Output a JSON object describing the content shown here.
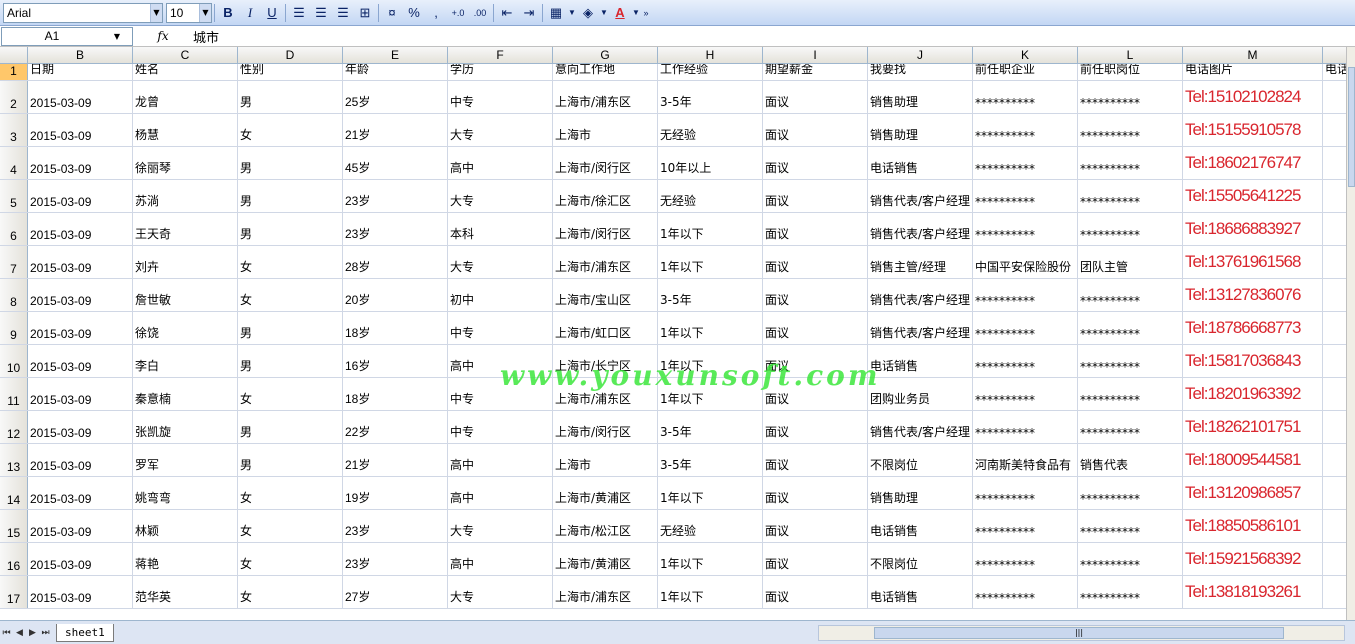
{
  "toolbar": {
    "font_name": "Arial",
    "font_size": "10",
    "bold": "B",
    "italic": "I",
    "underline": "U",
    "percent": "%",
    "comma": ",",
    "inc_decimal": "+.0",
    "dec_decimal": ".00",
    "font_color_label": "A"
  },
  "formula_bar": {
    "cell_ref": "A1",
    "fx": "fx",
    "content": "城市"
  },
  "columns": [
    "B",
    "C",
    "D",
    "E",
    "F",
    "G",
    "H",
    "I",
    "J",
    "K",
    "L",
    "M",
    ""
  ],
  "row_numbers": [
    "1",
    "2",
    "3",
    "4",
    "5",
    "6",
    "7",
    "8",
    "9",
    "10",
    "11",
    "12",
    "13",
    "14",
    "15",
    "16",
    "17"
  ],
  "header_row": [
    "日期",
    "姓名",
    "性别",
    "年龄",
    "学历",
    "意向工作地",
    "工作经验",
    "期望薪金",
    "我要找",
    "前任职企业",
    "前任职岗位",
    "电话图片",
    "电话"
  ],
  "rows": [
    [
      "2015-03-09",
      "龙曾",
      "男",
      "25岁",
      "中专",
      "上海市/浦东区",
      "3-5年",
      "面议",
      "销售助理",
      "**********",
      "**********",
      "Tel:15102102824"
    ],
    [
      "2015-03-09",
      "杨慧",
      "女",
      "21岁",
      "大专",
      "上海市",
      "无经验",
      "面议",
      "销售助理",
      "**********",
      "**********",
      "Tel:15155910578"
    ],
    [
      "2015-03-09",
      "徐丽琴",
      "男",
      "45岁",
      "高中",
      "上海市/闵行区",
      "10年以上",
      "面议",
      "电话销售",
      "**********",
      "**********",
      "Tel:18602176747"
    ],
    [
      "2015-03-09",
      "苏淌",
      "男",
      "23岁",
      "大专",
      "上海市/徐汇区",
      "无经验",
      "面议",
      "销售代表/客户经理",
      "**********",
      "**********",
      "Tel:15505641225"
    ],
    [
      "2015-03-09",
      "王天奇",
      "男",
      "23岁",
      "本科",
      "上海市/闵行区",
      "1年以下",
      "面议",
      "销售代表/客户经理",
      "**********",
      "**********",
      "Tel:18686883927"
    ],
    [
      "2015-03-09",
      "刘卉",
      "女",
      "28岁",
      "大专",
      "上海市/浦东区",
      "1年以下",
      "面议",
      "销售主管/经理",
      "中国平安保险股份",
      "团队主管",
      "Tel:13761961568"
    ],
    [
      "2015-03-09",
      "詹世敏",
      "女",
      "20岁",
      "初中",
      "上海市/宝山区",
      "3-5年",
      "面议",
      "销售代表/客户经理",
      "**********",
      "**********",
      "Tel:13127836076"
    ],
    [
      "2015-03-09",
      "徐饶",
      "男",
      "18岁",
      "中专",
      "上海市/虹口区",
      "1年以下",
      "面议",
      "销售代表/客户经理",
      "**********",
      "**********",
      "Tel:18786668773"
    ],
    [
      "2015-03-09",
      "李白",
      "男",
      "16岁",
      "高中",
      "上海市/长宁区",
      "1年以下",
      "面议",
      "电话销售",
      "**********",
      "**********",
      "Tel:15817036843"
    ],
    [
      "2015-03-09",
      "秦意楠",
      "女",
      "18岁",
      "中专",
      "上海市/浦东区",
      "1年以下",
      "面议",
      "团购业务员",
      "**********",
      "**********",
      "Tel:18201963392"
    ],
    [
      "2015-03-09",
      "张凯旋",
      "男",
      "22岁",
      "中专",
      "上海市/闵行区",
      "3-5年",
      "面议",
      "销售代表/客户经理",
      "**********",
      "**********",
      "Tel:18262101751"
    ],
    [
      "2015-03-09",
      "罗军",
      "男",
      "21岁",
      "高中",
      "上海市",
      "3-5年",
      "面议",
      "不限岗位",
      "河南斯美特食品有",
      "销售代表",
      "Tel:18009544581"
    ],
    [
      "2015-03-09",
      "姚弯弯",
      "女",
      "19岁",
      "高中",
      "上海市/黄浦区",
      "1年以下",
      "面议",
      "销售助理",
      "**********",
      "**********",
      "Tel:13120986857"
    ],
    [
      "2015-03-09",
      "林颖",
      "女",
      "23岁",
      "大专",
      "上海市/松江区",
      "无经验",
      "面议",
      "电话销售",
      "**********",
      "**********",
      "Tel:18850586101"
    ],
    [
      "2015-03-09",
      "蒋艳",
      "女",
      "23岁",
      "高中",
      "上海市/黄浦区",
      "1年以下",
      "面议",
      "不限岗位",
      "**********",
      "**********",
      "Tel:15921568392"
    ],
    [
      "2015-03-09",
      "范华英",
      "女",
      "27岁",
      "大专",
      "上海市/浦东区",
      "1年以下",
      "面议",
      "电话销售",
      "**********",
      "**********",
      "Tel:13818193261"
    ]
  ],
  "watermark": "www.youxunsoft.com",
  "sheet_tab": "sheet1",
  "phone_color": "#d9262e",
  "selection_color": "#ffc76a"
}
